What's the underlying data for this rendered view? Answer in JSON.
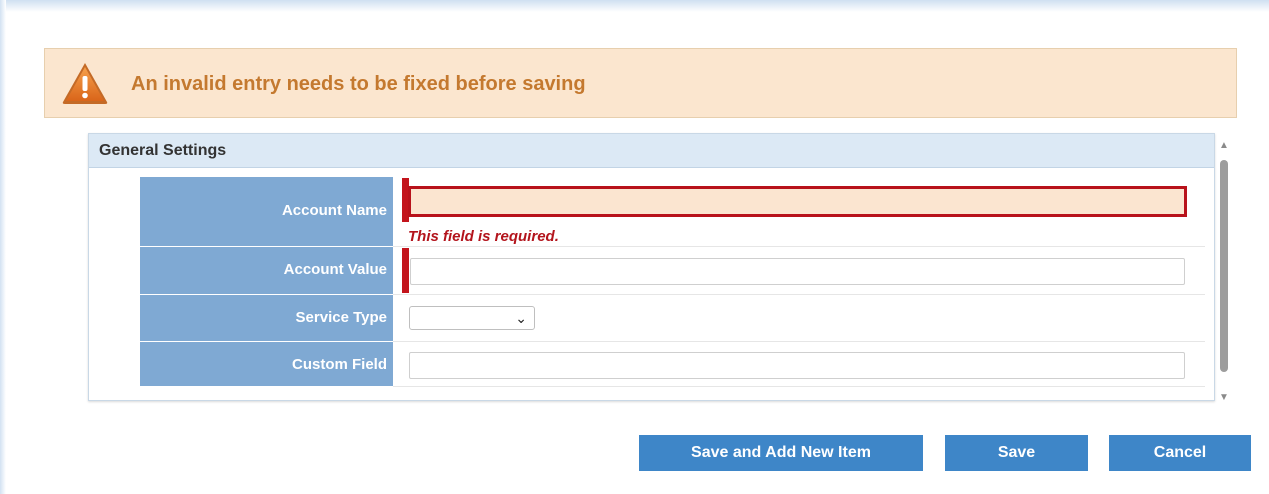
{
  "alert": {
    "message": "An invalid entry needs to be fixed before saving",
    "icon": "warning-icon"
  },
  "panel": {
    "title": "General Settings"
  },
  "form": {
    "fields": [
      {
        "label": "Account Name",
        "value": "",
        "required": true,
        "invalid": true,
        "error": "This field is required."
      },
      {
        "label": "Account Value",
        "value": "",
        "required": true,
        "invalid": false
      },
      {
        "label": "Service Type",
        "value": "",
        "type": "select"
      },
      {
        "label": "Custom Field",
        "value": ""
      }
    ]
  },
  "buttons": {
    "save_and_add": "Save and Add New Item",
    "save": "Save",
    "cancel": "Cancel"
  },
  "colors": {
    "accent": "#3e86c8",
    "label_bg": "#7fa9d3",
    "error": "#b3141c",
    "alert_bg": "#fbe6cf",
    "alert_text": "#c4792f"
  }
}
